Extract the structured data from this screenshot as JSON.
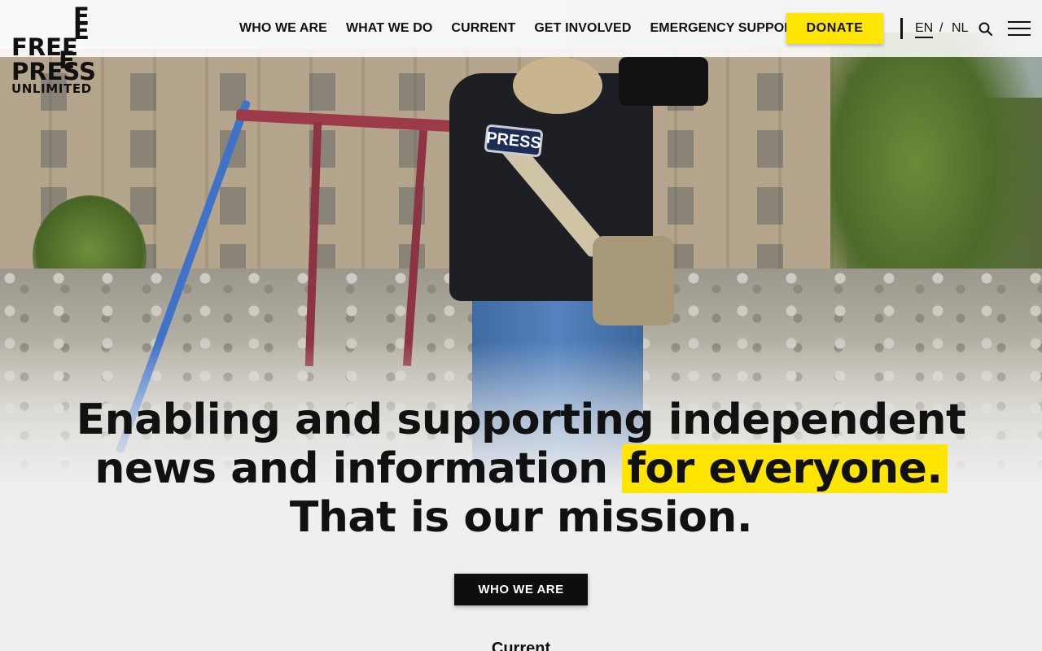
{
  "brand": {
    "logo_rows": [
      "E",
      "FREE",
      "E",
      "PRESS",
      "UNLIMITED"
    ],
    "logo_alt": "Free Press Unlimited"
  },
  "nav": {
    "items": [
      {
        "label": "WHO WE ARE"
      },
      {
        "label": "WHAT WE DO"
      },
      {
        "label": "CURRENT"
      },
      {
        "label": "GET INVOLVED"
      },
      {
        "label": "EMERGENCY SUPPORT"
      }
    ],
    "donate_label": "DONATE",
    "lang_en": "EN",
    "lang_sep": "/",
    "lang_nl": "NL"
  },
  "hero": {
    "press_patch": "PRESS",
    "headline_line1": "Enabling and supporting independent",
    "headline_line2_pre": "news and information ",
    "headline_line2_highlight": "for everyone.",
    "headline_line3": "That is our mission.",
    "cta_label": "WHO WE ARE"
  },
  "current": {
    "title": "Current"
  },
  "colors": {
    "accent_yellow": "#ffe500",
    "dark_button": "#0e0e0e",
    "page_bg": "#efefef"
  }
}
